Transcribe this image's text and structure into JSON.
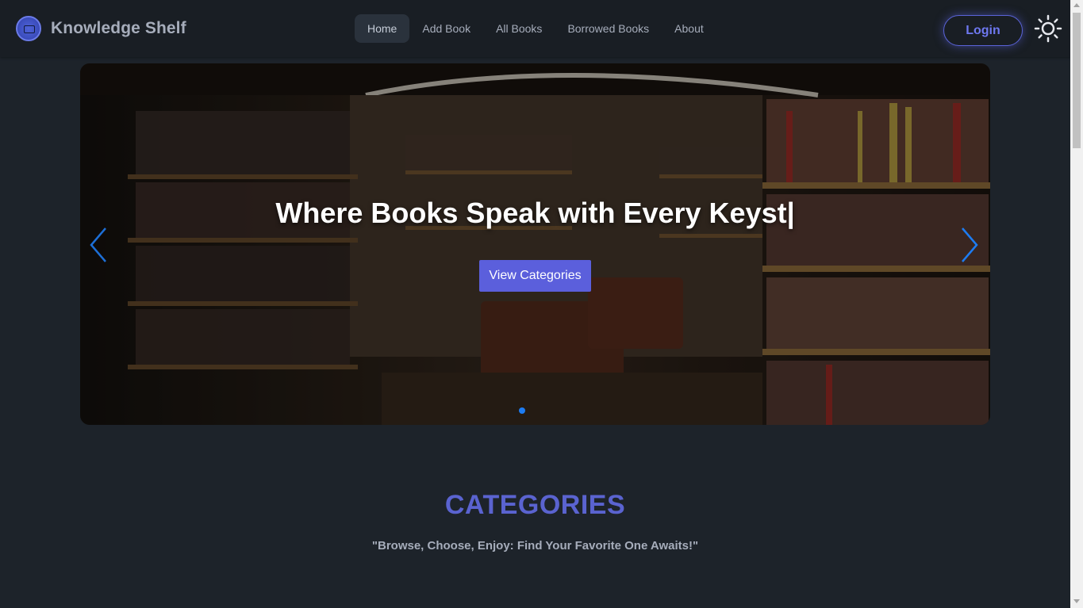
{
  "navbar": {
    "brand": "Knowledge Shelf",
    "menu": [
      {
        "label": "Home",
        "active": true
      },
      {
        "label": "Add Book",
        "active": false
      },
      {
        "label": "All Books",
        "active": false
      },
      {
        "label": "Borrowed Books",
        "active": false
      },
      {
        "label": "About",
        "active": false
      }
    ],
    "login_label": "Login",
    "theme_icon": "sun-icon"
  },
  "hero": {
    "title": "Where Books Speak with Every Keyst|",
    "button_label": "View Categories",
    "prev_icon": "chevron-left-icon",
    "next_icon": "chevron-right-icon"
  },
  "categories": {
    "title": "CATEGORIES",
    "subtitle": "\"Browse, Choose, Enjoy: Find Your Favorite One Awaits!\""
  },
  "colors": {
    "background": "#1d232a",
    "navbar": "#191e24",
    "accent": "#5b5fdc",
    "heading": "#5a63d0",
    "indicator": "#1d7cf2"
  }
}
